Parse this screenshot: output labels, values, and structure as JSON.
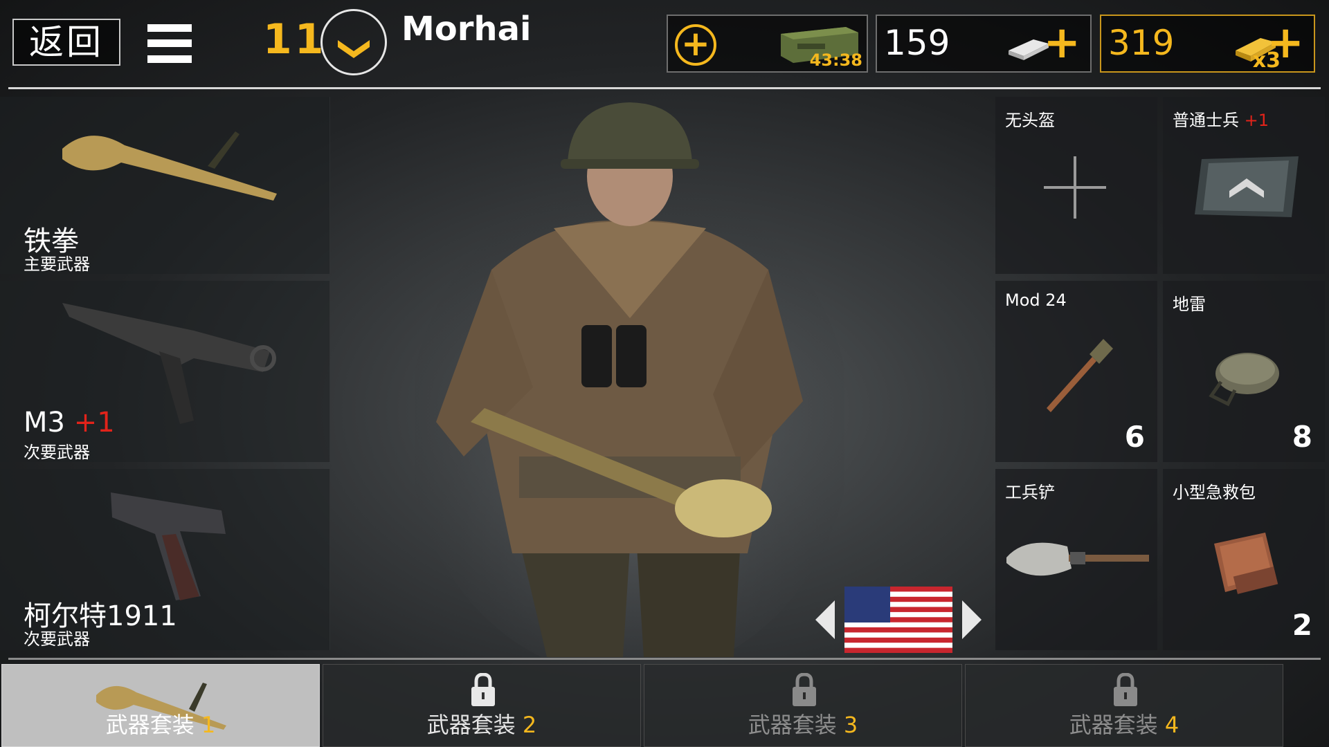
{
  "top_bar": {
    "back_label": "返回",
    "level": "11",
    "player_name": "Morhai",
    "crate_timer": "43:38",
    "silver_amount": "159",
    "gold_amount": "319",
    "gold_multiplier": "x3",
    "accent_color": "#f5b81e"
  },
  "weapons": [
    {
      "name": "铁拳",
      "plus": "",
      "type": "主要武器",
      "icon": "panzerfaust-icon"
    },
    {
      "name": "M3 ",
      "plus": "+1",
      "type": "次要武器",
      "icon": "smg-icon"
    },
    {
      "name": "柯尔特1911",
      "plus": "",
      "type": "次要武器",
      "icon": "pistol-icon"
    }
  ],
  "equipment": [
    {
      "label": "无头盔",
      "plus": "",
      "count": "",
      "icon": "add-slot-icon"
    },
    {
      "label": "普通士兵 ",
      "plus": "+1",
      "count": "",
      "icon": "rank-patch-icon"
    },
    {
      "label": "Mod 24",
      "plus": "",
      "count": "6",
      "icon": "stick-grenade-icon"
    },
    {
      "label": "地雷",
      "plus": "",
      "count": "8",
      "icon": "landmine-icon"
    },
    {
      "label": "工兵铲",
      "plus": "",
      "count": "",
      "icon": "shovel-icon"
    },
    {
      "label": "小型急救包",
      "plus": "",
      "count": "2",
      "icon": "first-aid-kit-icon"
    }
  ],
  "tabs": [
    {
      "label": "武器套装 ",
      "num": "1",
      "locked": false
    },
    {
      "label": "武器套装 ",
      "num": "2",
      "locked": true
    },
    {
      "label": "武器套装 ",
      "num": "3",
      "locked": true
    },
    {
      "label": "武器套装 ",
      "num": "4",
      "locked": true
    }
  ]
}
